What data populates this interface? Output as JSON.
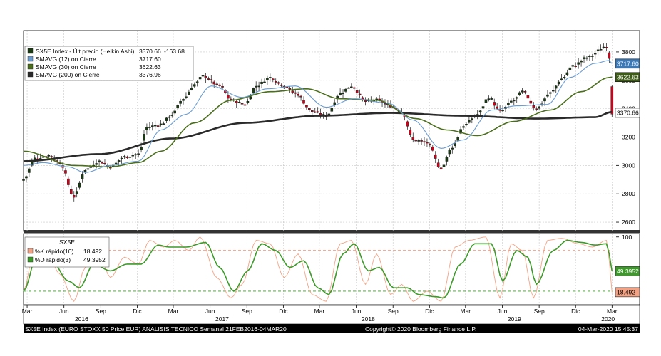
{
  "colors": {
    "background": "#ffffff",
    "panel_border": "#000000",
    "grid": "#c8c8c8",
    "up_candle": "#1a3a14",
    "down_candle": "#d0021b",
    "sma12": "#6a9cd0",
    "sma30": "#4a6e1c",
    "sma200": "#2a2a2a",
    "k_line": "#f2a385",
    "d_line": "#3d9a2a",
    "ref_line_upper": "#e77a5a",
    "ref_line_lower": "#3d9a2a",
    "divider": "#333333",
    "footer_bg": "#000000",
    "footer_text": "#ffffff"
  },
  "chart_data": [
    {
      "type": "candlestick",
      "series_label": "SX5E Index - Últ precio (Heikin Ashi)",
      "last_value": "3370.66",
      "change": "-163.68",
      "ylim": [
        2550,
        3900
      ],
      "y_ticks": [
        2600,
        2800,
        3000,
        3200,
        3400,
        3600,
        3800
      ],
      "y_tick_labels": [
        "2600",
        "2800",
        "3000",
        "3200",
        "3400",
        "3600",
        "3800"
      ],
      "x_start": "2016-02-21",
      "x_end": "2020-03-04",
      "anchors": [
        [
          "2016-02-21",
          2900
        ],
        [
          "2016-03-20",
          3050
        ],
        [
          "2016-04-24",
          3070
        ],
        [
          "2016-05-22",
          3020
        ],
        [
          "2016-06-26",
          2780
        ],
        [
          "2016-07-24",
          2970
        ],
        [
          "2016-08-28",
          3030
        ],
        [
          "2016-09-25",
          2990
        ],
        [
          "2016-10-30",
          3060
        ],
        [
          "2016-12-04",
          3080
        ],
        [
          "2016-12-25",
          3270
        ],
        [
          "2017-01-29",
          3290
        ],
        [
          "2017-02-26",
          3360
        ],
        [
          "2017-03-26",
          3470
        ],
        [
          "2017-04-23",
          3570
        ],
        [
          "2017-05-14",
          3630
        ],
        [
          "2017-06-25",
          3560
        ],
        [
          "2017-07-23",
          3460
        ],
        [
          "2017-08-27",
          3430
        ],
        [
          "2017-09-24",
          3560
        ],
        [
          "2017-10-29",
          3620
        ],
        [
          "2017-11-26",
          3570
        ],
        [
          "2017-12-31",
          3510
        ],
        [
          "2018-02-11",
          3380
        ],
        [
          "2018-03-18",
          3350
        ],
        [
          "2018-04-22",
          3510
        ],
        [
          "2018-05-20",
          3560
        ],
        [
          "2018-06-24",
          3450
        ],
        [
          "2018-07-22",
          3460
        ],
        [
          "2018-08-26",
          3420
        ],
        [
          "2018-09-23",
          3380
        ],
        [
          "2018-10-21",
          3180
        ],
        [
          "2018-11-25",
          3160
        ],
        [
          "2018-12-30",
          2980
        ],
        [
          "2019-01-27",
          3130
        ],
        [
          "2019-02-24",
          3280
        ],
        [
          "2019-03-31",
          3360
        ],
        [
          "2019-04-28",
          3480
        ],
        [
          "2019-05-26",
          3380
        ],
        [
          "2019-06-30",
          3460
        ],
        [
          "2019-07-21",
          3520
        ],
        [
          "2019-08-25",
          3400
        ],
        [
          "2019-09-29",
          3510
        ],
        [
          "2019-10-27",
          3610
        ],
        [
          "2019-11-24",
          3700
        ],
        [
          "2019-12-29",
          3760
        ],
        [
          "2020-02-16",
          3840
        ],
        [
          "2020-02-23",
          3760
        ],
        [
          "2020-03-01",
          3370
        ]
      ],
      "sma12_anchors": [
        [
          "2016-02-21",
          3000
        ],
        [
          "2016-04-10",
          3020
        ],
        [
          "2016-06-12",
          2990
        ],
        [
          "2016-07-24",
          2950
        ],
        [
          "2016-09-25",
          3000
        ],
        [
          "2016-12-04",
          3030
        ],
        [
          "2017-01-29",
          3250
        ],
        [
          "2017-04-02",
          3360
        ],
        [
          "2017-06-04",
          3560
        ],
        [
          "2017-08-20",
          3480
        ],
        [
          "2017-10-22",
          3540
        ],
        [
          "2017-12-31",
          3560
        ],
        [
          "2018-03-18",
          3410
        ],
        [
          "2018-05-27",
          3470
        ],
        [
          "2018-08-19",
          3440
        ],
        [
          "2018-10-21",
          3320
        ],
        [
          "2018-12-30",
          3120
        ],
        [
          "2019-02-24",
          3180
        ],
        [
          "2019-05-05",
          3390
        ],
        [
          "2019-07-07",
          3420
        ],
        [
          "2019-09-22",
          3430
        ],
        [
          "2019-11-17",
          3620
        ],
        [
          "2020-01-19",
          3720
        ],
        [
          "2020-02-23",
          3740
        ],
        [
          "2020-03-01",
          3717.6
        ]
      ],
      "sma30_anchors": [
        [
          "2016-02-21",
          3100
        ],
        [
          "2016-06-26",
          3000
        ],
        [
          "2016-09-25",
          2990
        ],
        [
          "2016-12-04",
          3020
        ],
        [
          "2017-01-29",
          3100
        ],
        [
          "2017-04-23",
          3300
        ],
        [
          "2017-07-23",
          3460
        ],
        [
          "2017-10-29",
          3520
        ],
        [
          "2018-01-28",
          3540
        ],
        [
          "2018-04-22",
          3470
        ],
        [
          "2018-07-22",
          3460
        ],
        [
          "2018-10-28",
          3330
        ],
        [
          "2019-01-13",
          3250
        ],
        [
          "2019-03-31",
          3210
        ],
        [
          "2019-06-30",
          3310
        ],
        [
          "2019-09-29",
          3390
        ],
        [
          "2019-12-15",
          3520
        ],
        [
          "2020-02-23",
          3620
        ],
        [
          "2020-03-01",
          3622.63
        ]
      ],
      "sma200_anchors": [
        [
          "2016-02-21",
          3030
        ],
        [
          "2016-08-28",
          3080
        ],
        [
          "2017-02-26",
          3190
        ],
        [
          "2017-08-27",
          3300
        ],
        [
          "2018-02-25",
          3350
        ],
        [
          "2018-08-26",
          3370
        ],
        [
          "2019-02-24",
          3350
        ],
        [
          "2019-08-25",
          3330
        ],
        [
          "2020-01-19",
          3340
        ],
        [
          "2020-03-01",
          3376.96
        ]
      ],
      "legend": [
        {
          "label": "SX5E Index - Últ precio (Heikin Ashi)",
          "value": "3370.66",
          "change": "-163.68",
          "color": "#1a3a14"
        },
        {
          "label": "SMAVG (12)  on Cierre",
          "value": "3717.60",
          "color": "#6a9cd0"
        },
        {
          "label": "SMAVG (30)  on Cierre",
          "value": "3622.63",
          "color": "#4a6e1c"
        },
        {
          "label": "SMAVG (200)  on Cierre",
          "value": "3376.96",
          "color": "#2a2a2a"
        }
      ],
      "value_tags": [
        {
          "value": "3717.60",
          "y": 3717.6,
          "color": "#3a78b8",
          "text_color": "#ffffff"
        },
        {
          "value": "3622.63",
          "y": 3622.63,
          "color": "#3d5a18",
          "text_color": "#ffffff"
        },
        {
          "value": "3370.66",
          "y": 3370.66,
          "color": "#ffffff",
          "text_color": "#000000"
        }
      ]
    },
    {
      "type": "line",
      "panel_title": "SX5E",
      "ylim": [
        0,
        105
      ],
      "y_ticks": [
        100
      ],
      "y_tick_labels": [
        "100"
      ],
      "reference_lines": [
        80,
        20
      ],
      "series": [
        {
          "name": "%K rápido(10)",
          "last_value": "18.492",
          "color": "#f2a385",
          "anchors": [
            [
              "2016-02-21",
              20
            ],
            [
              "2016-03-20",
              85
            ],
            [
              "2016-04-24",
              70
            ],
            [
              "2016-05-22",
              45
            ],
            [
              "2016-06-26",
              5
            ],
            [
              "2016-07-24",
              55
            ],
            [
              "2016-08-28",
              75
            ],
            [
              "2016-09-25",
              40
            ],
            [
              "2016-10-30",
              70
            ],
            [
              "2016-12-04",
              60
            ],
            [
              "2017-01-01",
              95
            ],
            [
              "2017-02-05",
              85
            ],
            [
              "2017-03-05",
              95
            ],
            [
              "2017-04-09",
              80
            ],
            [
              "2017-05-07",
              100
            ],
            [
              "2017-06-18",
              40
            ],
            [
              "2017-07-23",
              10
            ],
            [
              "2017-08-20",
              30
            ],
            [
              "2017-09-24",
              95
            ],
            [
              "2017-10-29",
              90
            ],
            [
              "2017-12-03",
              40
            ],
            [
              "2018-01-07",
              75
            ],
            [
              "2018-02-11",
              15
            ],
            [
              "2018-03-18",
              5
            ],
            [
              "2018-04-22",
              90
            ],
            [
              "2018-05-20",
              95
            ],
            [
              "2018-06-24",
              30
            ],
            [
              "2018-07-22",
              75
            ],
            [
              "2018-08-26",
              15
            ],
            [
              "2018-09-23",
              30
            ],
            [
              "2018-10-21",
              5
            ],
            [
              "2018-11-25",
              20
            ],
            [
              "2018-12-30",
              5
            ],
            [
              "2019-02-03",
              85
            ],
            [
              "2019-03-10",
              95
            ],
            [
              "2019-04-21",
              100
            ],
            [
              "2019-05-26",
              10
            ],
            [
              "2019-06-23",
              90
            ],
            [
              "2019-07-21",
              80
            ],
            [
              "2019-08-18",
              10
            ],
            [
              "2019-09-22",
              95
            ],
            [
              "2019-10-27",
              98
            ],
            [
              "2019-12-08",
              90
            ],
            [
              "2020-01-12",
              85
            ],
            [
              "2020-02-16",
              95
            ],
            [
              "2020-02-23",
              65
            ],
            [
              "2020-03-01",
              18.492
            ]
          ]
        },
        {
          "name": "%D rápido(3)",
          "last_value": "49.3952",
          "color": "#3d9a2a",
          "anchors": [
            [
              "2016-02-21",
              20
            ],
            [
              "2016-03-27",
              75
            ],
            [
              "2016-05-01",
              65
            ],
            [
              "2016-06-12",
              35
            ],
            [
              "2016-07-10",
              25
            ],
            [
              "2016-08-14",
              60
            ],
            [
              "2016-09-25",
              50
            ],
            [
              "2016-11-06",
              60
            ],
            [
              "2016-12-11",
              60
            ],
            [
              "2017-01-22",
              88
            ],
            [
              "2017-02-19",
              85
            ],
            [
              "2017-04-02",
              85
            ],
            [
              "2017-05-21",
              92
            ],
            [
              "2017-06-25",
              55
            ],
            [
              "2017-07-30",
              20
            ],
            [
              "2017-09-03",
              50
            ],
            [
              "2017-10-08",
              90
            ],
            [
              "2017-11-12",
              80
            ],
            [
              "2017-12-17",
              55
            ],
            [
              "2018-01-21",
              65
            ],
            [
              "2018-02-25",
              25
            ],
            [
              "2018-03-25",
              15
            ],
            [
              "2018-04-29",
              75
            ],
            [
              "2018-05-27",
              90
            ],
            [
              "2018-07-01",
              50
            ],
            [
              "2018-07-29",
              55
            ],
            [
              "2018-09-02",
              25
            ],
            [
              "2018-10-07",
              25
            ],
            [
              "2018-11-04",
              15
            ],
            [
              "2018-12-16",
              12
            ],
            [
              "2019-01-06",
              10
            ],
            [
              "2019-02-17",
              60
            ],
            [
              "2019-03-24",
              90
            ],
            [
              "2019-05-05",
              90
            ],
            [
              "2019-06-02",
              35
            ],
            [
              "2019-07-07",
              80
            ],
            [
              "2019-08-04",
              70
            ],
            [
              "2019-08-25",
              30
            ],
            [
              "2019-10-06",
              80
            ],
            [
              "2019-11-10",
              95
            ],
            [
              "2019-12-15",
              92
            ],
            [
              "2020-01-19",
              88
            ],
            [
              "2020-02-16",
              90
            ],
            [
              "2020-02-23",
              75
            ],
            [
              "2020-03-01",
              49.3952
            ]
          ]
        }
      ],
      "legend": [
        {
          "label": "%K rápido(10)",
          "value": "18.492",
          "color": "#f2a385"
        },
        {
          "label": "%D rápido(3)",
          "value": "49.3952",
          "color": "#3d9a2a"
        }
      ],
      "value_tags": [
        {
          "value": "49.3952",
          "y": 49.3952,
          "color": "#3d9a2a",
          "text_color": "#ffffff"
        },
        {
          "value": "18.492",
          "y": 18.492,
          "color": "#f2a385",
          "text_color": "#000000"
        }
      ]
    }
  ],
  "x_axis": {
    "months": [
      {
        "label": "Mar",
        "date": "2016-03-01"
      },
      {
        "label": "Jun",
        "date": "2016-06-01"
      },
      {
        "label": "Sep",
        "date": "2016-09-01"
      },
      {
        "label": "Dic",
        "date": "2016-12-01"
      },
      {
        "label": "Mar",
        "date": "2017-03-01"
      },
      {
        "label": "Jun",
        "date": "2017-06-01"
      },
      {
        "label": "Sep",
        "date": "2017-09-01"
      },
      {
        "label": "Dic",
        "date": "2017-12-01"
      },
      {
        "label": "Mar",
        "date": "2018-03-01"
      },
      {
        "label": "Jun",
        "date": "2018-06-01"
      },
      {
        "label": "Sep",
        "date": "2018-09-01"
      },
      {
        "label": "Dic",
        "date": "2018-12-01"
      },
      {
        "label": "Mar",
        "date": "2019-03-01"
      },
      {
        "label": "Jun",
        "date": "2019-06-01"
      },
      {
        "label": "Sep",
        "date": "2019-09-01"
      },
      {
        "label": "Dic",
        "date": "2019-12-01"
      },
      {
        "label": "Mar",
        "date": "2020-03-01"
      }
    ],
    "years": [
      {
        "label": "2016",
        "date": "2016-07-15"
      },
      {
        "label": "2017",
        "date": "2017-07-01"
      },
      {
        "label": "2018",
        "date": "2018-07-01"
      },
      {
        "label": "2019",
        "date": "2019-07-01"
      },
      {
        "label": "2020",
        "date": "2020-02-20"
      }
    ]
  },
  "footer": {
    "left": "SX5E Index (EURO STOXX 50 Price EUR) ANALISIS TECNICO  Semanal 21FEB2016-04MAR20",
    "center": "Copyright© 2020 Bloomberg Finance L.P.",
    "right": "04-Mar-2020 15:45:37"
  }
}
